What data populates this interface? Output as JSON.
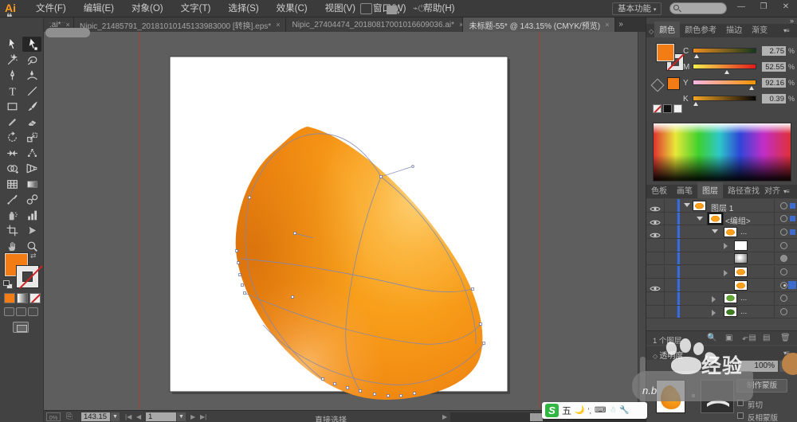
{
  "menu": {
    "logo": "Ai",
    "items": [
      "文件(F)",
      "编辑(E)",
      "对象(O)",
      "文字(T)",
      "选择(S)",
      "效果(C)",
      "视图(V)",
      "窗口(W)",
      "帮助(H)"
    ],
    "workspace": "基本功能",
    "window_buttons": {
      "minimize": "—",
      "restore": "❐",
      "close": "✕"
    }
  },
  "tabs": {
    "docs": [
      {
        "label": ".ai*",
        "close": "×"
      },
      {
        "label": "Nipic_21485791_20181010145133983000 [转换].eps*",
        "close": "×"
      },
      {
        "label": "Nipic_27404474_20180817001016609036.ai*",
        "close": "×"
      },
      {
        "label": "未标题-55* @ 143.15% (CMYK/预览)",
        "close": "×"
      }
    ],
    "overflow": "»",
    "dock_collapse": "»"
  },
  "toolbar_tools": [
    "selection",
    "direct-selection",
    "magic-wand",
    "lasso",
    "pen",
    "curvature",
    "type",
    "line-segment",
    "rectangle",
    "paintbrush",
    "pencil",
    "eraser",
    "rotate",
    "scale",
    "width",
    "puppet-warp",
    "shape-builder",
    "perspective-grid",
    "mesh",
    "gradient",
    "eyedropper",
    "blend",
    "symbol-sprayer",
    "column-graph",
    "artboard",
    "slice",
    "hand",
    "zoom"
  ],
  "color_panel": {
    "tabs": [
      "颜色",
      "颜色参考",
      "描边",
      "渐变"
    ],
    "active_tab": "颜色",
    "sliders": [
      {
        "label": "C",
        "value": "2.75",
        "unit": "%",
        "percent": 3
      },
      {
        "label": "M",
        "value": "52.55",
        "unit": "%",
        "percent": 53
      },
      {
        "label": "Y",
        "value": "92.16",
        "unit": "%",
        "percent": 92
      },
      {
        "label": "K",
        "value": "0.39",
        "unit": "%",
        "percent": 1
      }
    ],
    "fill_color": "#F47C14"
  },
  "panel_tabs": {
    "items": [
      "色板",
      "画笔",
      "图层",
      "路径查找器",
      "对齐"
    ],
    "active": "图层"
  },
  "layers": {
    "rows": [
      {
        "name": "图层 1"
      },
      {
        "name": "<编组>"
      },
      {
        "name": "..."
      },
      {
        "name": ""
      },
      {
        "name": ""
      },
      {
        "name": ""
      },
      {
        "name": ""
      },
      {
        "name": "..."
      },
      {
        "name": "..."
      }
    ],
    "count_label": "1 个图层"
  },
  "transparency": {
    "title": "透明度",
    "opacity": "100%",
    "mask_button": "制作蒙版",
    "clip_label": "剪切",
    "invert_label": "反相蒙版"
  },
  "statusbar": {
    "gpu_label": "0%",
    "zoom": "143.15",
    "artboard": "1",
    "tool_label": "直接选择"
  },
  "ime": {
    "logo": "S",
    "wubi": "五"
  },
  "watermark": {
    "quote": "❝",
    "brand": "经验",
    "fragment": "n.b"
  },
  "accent_colors": {
    "selection_blue": "#3d6bd0",
    "fill_orange": "#F47C14",
    "guide_red": "#a04438"
  }
}
